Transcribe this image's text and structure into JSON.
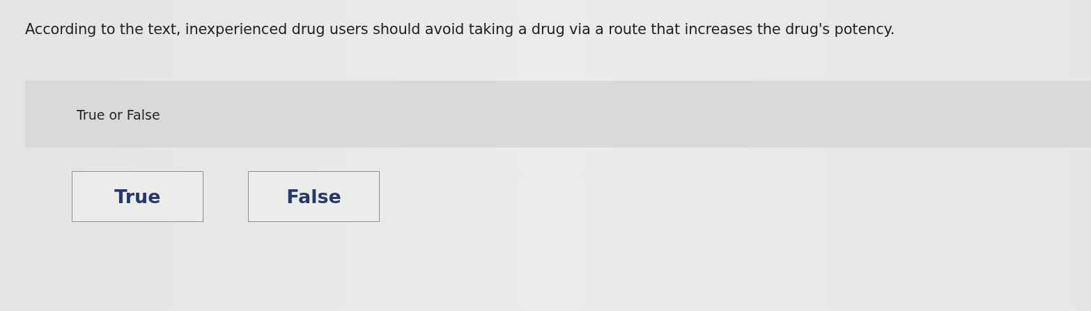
{
  "question": {
    "text": "According to the text, inexperienced drug users should avoid taking a drug via a route that increases the drug's potency."
  },
  "answer_panel": {
    "prompt": "True or False"
  },
  "options": [
    {
      "label": "True",
      "selected": false
    },
    {
      "label": "False",
      "selected": false
    }
  ]
}
